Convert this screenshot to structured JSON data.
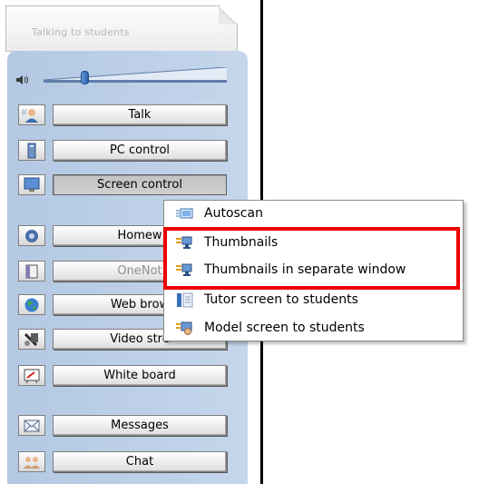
{
  "title": "Talking to students",
  "volume": {
    "icon": "speaker-icon",
    "level": 0.22
  },
  "buttons": [
    {
      "label": "Talk",
      "icon": "talk-person-icon",
      "state": "normal"
    },
    {
      "label": "PC control",
      "icon": "pc-tower-icon",
      "state": "normal"
    },
    {
      "label": "Screen control",
      "icon": "monitor-icon",
      "state": "pressed"
    },
    {
      "label": "Homew",
      "icon": "homework-icon",
      "state": "normal"
    },
    {
      "label": "OneNot",
      "icon": "onenote-icon",
      "state": "disabled"
    },
    {
      "label": "Web brow",
      "icon": "globe-icon",
      "state": "normal"
    },
    {
      "label": "Video stre",
      "icon": "video-icon",
      "state": "normal"
    },
    {
      "label": "White board",
      "icon": "whiteboard-icon",
      "state": "normal"
    },
    {
      "label": "Messages",
      "icon": "envelope-icon",
      "state": "normal"
    },
    {
      "label": "Chat",
      "icon": "chat-people-icon",
      "state": "normal"
    }
  ],
  "menu": {
    "items": [
      {
        "label": "Autoscan",
        "icon": "autoscan-icon"
      },
      {
        "label": "Thumbnails",
        "icon": "thumbnails-icon"
      },
      {
        "label": "Thumbnails in separate window",
        "icon": "thumbnails-window-icon"
      },
      {
        "label": "Tutor screen to students",
        "icon": "tutor-screen-icon"
      },
      {
        "label": "Model screen to students",
        "icon": "model-screen-icon"
      }
    ],
    "highlighted": [
      "Thumbnails",
      "Thumbnails in separate window"
    ],
    "highlight_color": "#ee0000"
  },
  "colors": {
    "panel": "#b3c8e2",
    "slider_thumb": "#2d5fae"
  }
}
